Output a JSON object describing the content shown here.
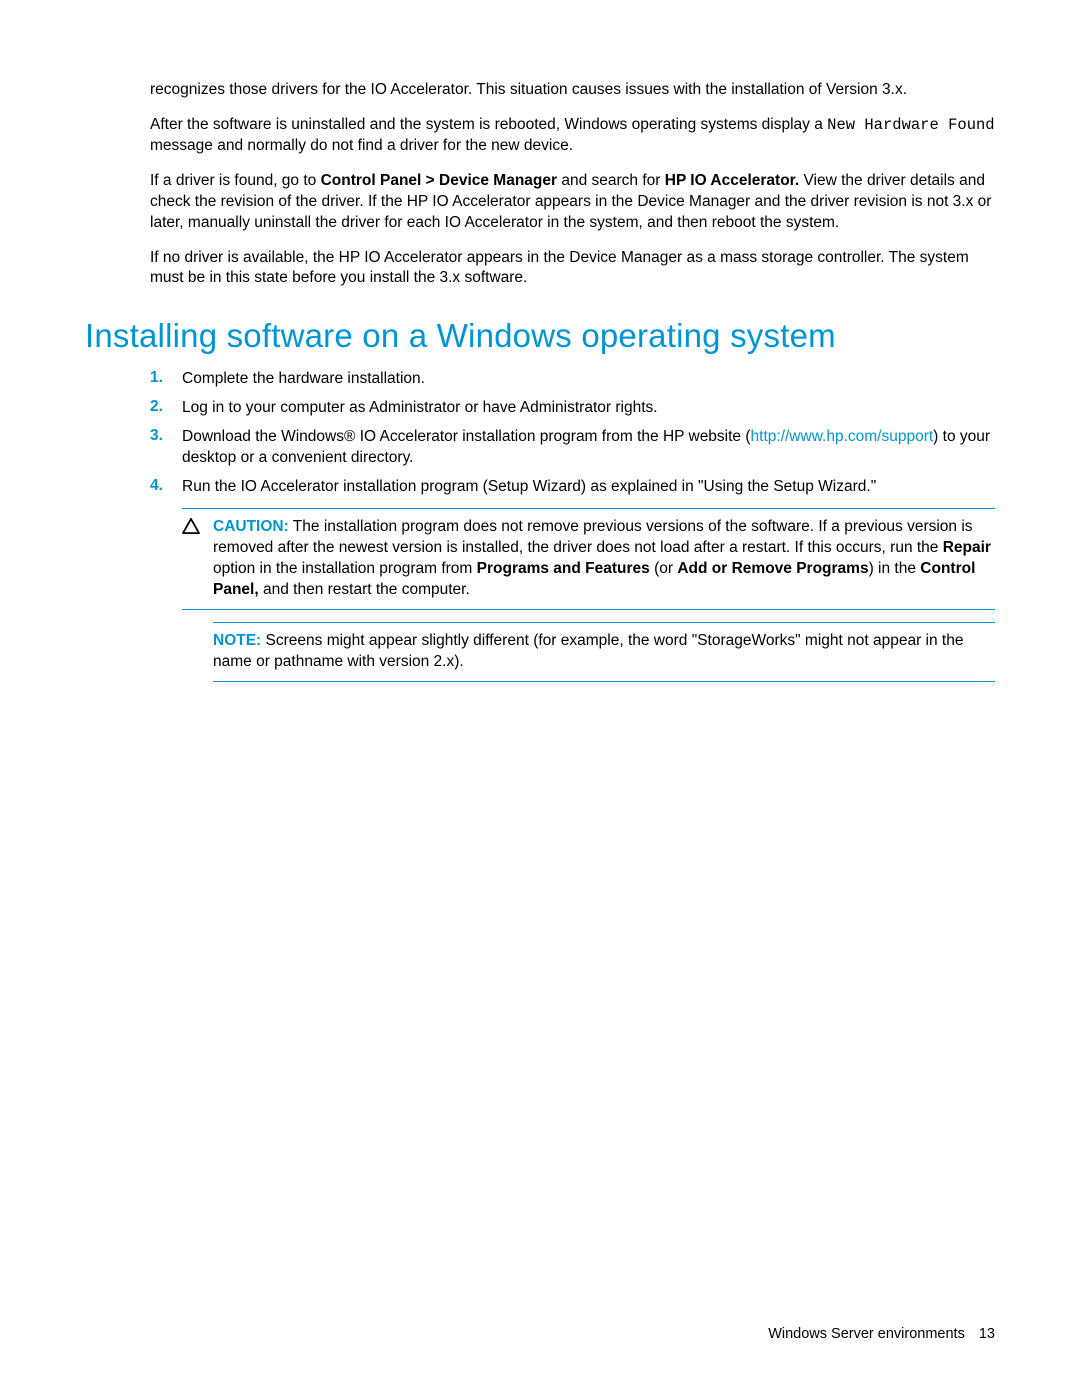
{
  "paragraphs": {
    "p1": "recognizes those drivers for the IO Accelerator. This situation causes issues with the installation of Version 3.x.",
    "p2a": "After the software is uninstalled and the system is rebooted, Windows operating systems display a ",
    "p2_mono": "New Hardware Found",
    "p2b": " message and normally do not find a driver for the new device.",
    "p3a": "If a driver is found, go to ",
    "p3_bold1": "Control Panel > Device Manager",
    "p3b": " and search for ",
    "p3_bold2": "HP IO Accelerator.",
    "p3c": " View the driver details and check the revision of the driver. If the HP IO Accelerator appears in the Device Manager and the driver revision is not 3.x or later, manually uninstall the driver for each IO Accelerator in the system, and then reboot the system.",
    "p4": "If no driver is available, the HP IO Accelerator appears in the Device Manager as a mass storage controller. The system must be in this state before you install the 3.x software."
  },
  "heading": "Installing software on a Windows operating system",
  "steps": [
    {
      "num": "1.",
      "text": "Complete the hardware installation."
    },
    {
      "num": "2.",
      "text": "Log in to your computer as Administrator or have Administrator rights."
    },
    {
      "num": "3.",
      "text_a": "Download the Windows® IO Accelerator installation program from the HP website (",
      "link": "http://www.hp.com/support",
      "text_b": ") to your desktop or a convenient directory."
    },
    {
      "num": "4.",
      "text": "Run the IO Accelerator installation program (Setup Wizard) as explained in \"Using the Setup Wizard.\""
    }
  ],
  "caution": {
    "label": "CAUTION:",
    "t1": "  The installation program does not remove previous versions of the software. If a previous version is removed after the newest version is installed, the driver does not load after a restart. If this occurs, run the ",
    "b1": "Repair",
    "t2": " option in the installation program from ",
    "b2": "Programs and Features",
    "t3": " (or ",
    "b3": "Add or Remove Programs",
    "t4": ") in the ",
    "b4": "Control Panel,",
    "t5": " and then restart the computer."
  },
  "note": {
    "label": "NOTE:",
    "text": "  Screens might appear slightly different (for example, the word \"StorageWorks\" might not appear in the name or pathname with version 2.x)."
  },
  "footer": {
    "section": "Windows Server environments",
    "page": "13"
  }
}
